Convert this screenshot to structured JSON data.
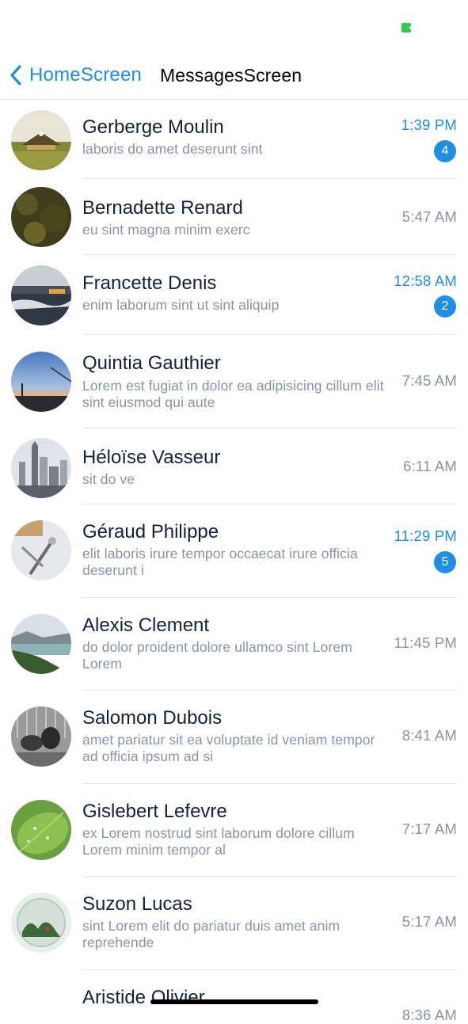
{
  "nav": {
    "back_label": "HomeScreen",
    "title": "MessagesScreen"
  },
  "colors": {
    "accent": "#1f8fe5",
    "name": "#14213d",
    "muted": "#8a93a6",
    "battery": "#2ecc4a"
  },
  "conversations": [
    {
      "name": "Gerberge Moulin",
      "preview": "laboris do amet deserunt sint",
      "time": "1:39 PM",
      "unread": "4"
    },
    {
      "name": "Bernadette Renard",
      "preview": "eu sint magna minim exerc",
      "time": "5:47 AM"
    },
    {
      "name": "Francette Denis",
      "preview": "enim laborum sint ut sint aliquip",
      "time": "12:58 AM",
      "unread": "2"
    },
    {
      "name": "Quintia Gauthier",
      "preview": "Lorem est fugiat in dolor ea adipisicing cillum elit sint eiusmod qui aute",
      "time": "7:45 AM"
    },
    {
      "name": "Héloïse Vasseur",
      "preview": "sit do ve",
      "time": "6:11 AM"
    },
    {
      "name": "Géraud Philippe",
      "preview": "elit laboris irure tempor occaecat irure officia deserunt i",
      "time": "11:29 PM",
      "unread": "5"
    },
    {
      "name": "Alexis Clement",
      "preview": "do dolor proident dolore ullamco sint Lorem Lorem",
      "time": "11:45 PM"
    },
    {
      "name": "Salomon Dubois",
      "preview": "amet pariatur sit ea voluptate id veniam tempor ad officia ipsum ad si",
      "time": "8:41 AM"
    },
    {
      "name": "Gislebert Lefevre",
      "preview": "ex Lorem nostrud sint laborum dolore cillum Lorem minim tempor al",
      "time": "7:17 AM"
    },
    {
      "name": "Suzon Lucas",
      "preview": "sint Lorem elit do pariatur duis amet anim reprehende",
      "time": "5:17 AM"
    },
    {
      "name": "Aristide Olivier",
      "time": "8:36 AM"
    }
  ]
}
